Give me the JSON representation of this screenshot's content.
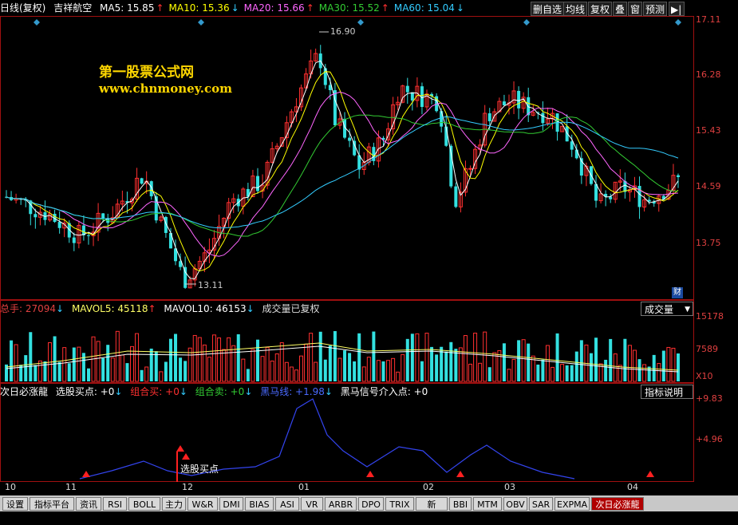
{
  "header": {
    "period": "日线(复权)",
    "stock": "吉祥航空",
    "ma": [
      {
        "label": "MA5: 15.85",
        "arrow": "↑",
        "color": "#ffffff"
      },
      {
        "label": "MA10: 15.36",
        "arrow": "↓",
        "color": "#ffff00"
      },
      {
        "label": "MA20: 15.66",
        "arrow": "↑",
        "color": "#ff66ff"
      },
      {
        "label": "MA30: 15.52",
        "arrow": "↑",
        "color": "#33cc33"
      },
      {
        "label": "MA60: 15.04",
        "arrow": "↓",
        "color": "#33ccff"
      }
    ]
  },
  "toolbar": {
    "del_label": "删自选",
    "avg_label": "均线",
    "restore_label": "复权",
    "overlay_label": "叠",
    "window_label": "窗",
    "forecast_label": "预测",
    "arrow_label": "▶|"
  },
  "watermark": {
    "line1": "第一股票公式网",
    "line2": "www.chnmoney.com"
  },
  "price_axis": [
    "17.11",
    "16.28",
    "15.43",
    "14.59",
    "13.75"
  ],
  "price_annot": {
    "high": "16.90",
    "low": "13.11",
    "cai": "财"
  },
  "volume": {
    "total": "总手: 27094",
    "total_arrow": "↓",
    "mavol5": "MAVOL5: 45118",
    "mavol5_arrow": "↑",
    "mavol10": "MAVOL10: 46153",
    "mavol10_arrow": "↓",
    "note": "成交量已复权",
    "axis": [
      "15178",
      "7589",
      "X10"
    ],
    "dropdown": "成交量"
  },
  "indicator": {
    "name": "次日必涨龍",
    "buy": "选股买点: +0",
    "buy_arrow": "↓",
    "combo_buy": "组合买: +0",
    "combo_buy_arrow": "↓",
    "combo_sell": "组合卖: +0",
    "combo_sell_arrow": "↓",
    "black_horse": "黑马线: +1.98",
    "black_horse_arrow": "↓",
    "entry": "黑马信号介入点: +0",
    "explain": "指标说明",
    "axis": [
      "+9.83",
      "+4.96"
    ],
    "buy_label": "选股买点"
  },
  "dates": [
    "10",
    "11",
    "12",
    "01",
    "02",
    "03",
    "04"
  ],
  "tabs": [
    "设置",
    "指标平台",
    "资讯",
    "RSI",
    "BOLL",
    "主力",
    "W&R",
    "DMI",
    "BIAS",
    "ASI",
    "VR",
    "ARBR",
    "DPO",
    "TRIX",
    "新DMA",
    "BBI",
    "MTM",
    "OBV",
    "SAR",
    "EXPMA",
    "次日必涨龍"
  ],
  "colors": {
    "up": "#ff3030",
    "down": "#33e0e0",
    "frame": "#a01010"
  }
}
